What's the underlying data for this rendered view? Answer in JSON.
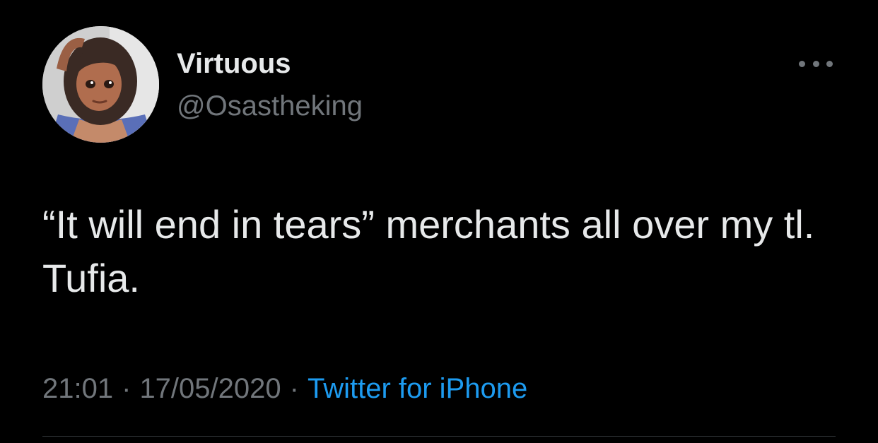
{
  "tweet": {
    "author": {
      "display_name": "Virtuous",
      "handle": "@Osastheking"
    },
    "text": "“It will end in tears” merchants all over my tl. Tufia.",
    "time": "21:01",
    "date": "17/05/2020",
    "separator": "·",
    "source": "Twitter for iPhone"
  },
  "icons": {
    "more": "more-horizontal-icon"
  },
  "colors": {
    "background": "#000000",
    "primary_text": "#e7e9ea",
    "secondary_text": "#71767b",
    "link": "#1d9bf0",
    "divider": "#2f3336"
  }
}
